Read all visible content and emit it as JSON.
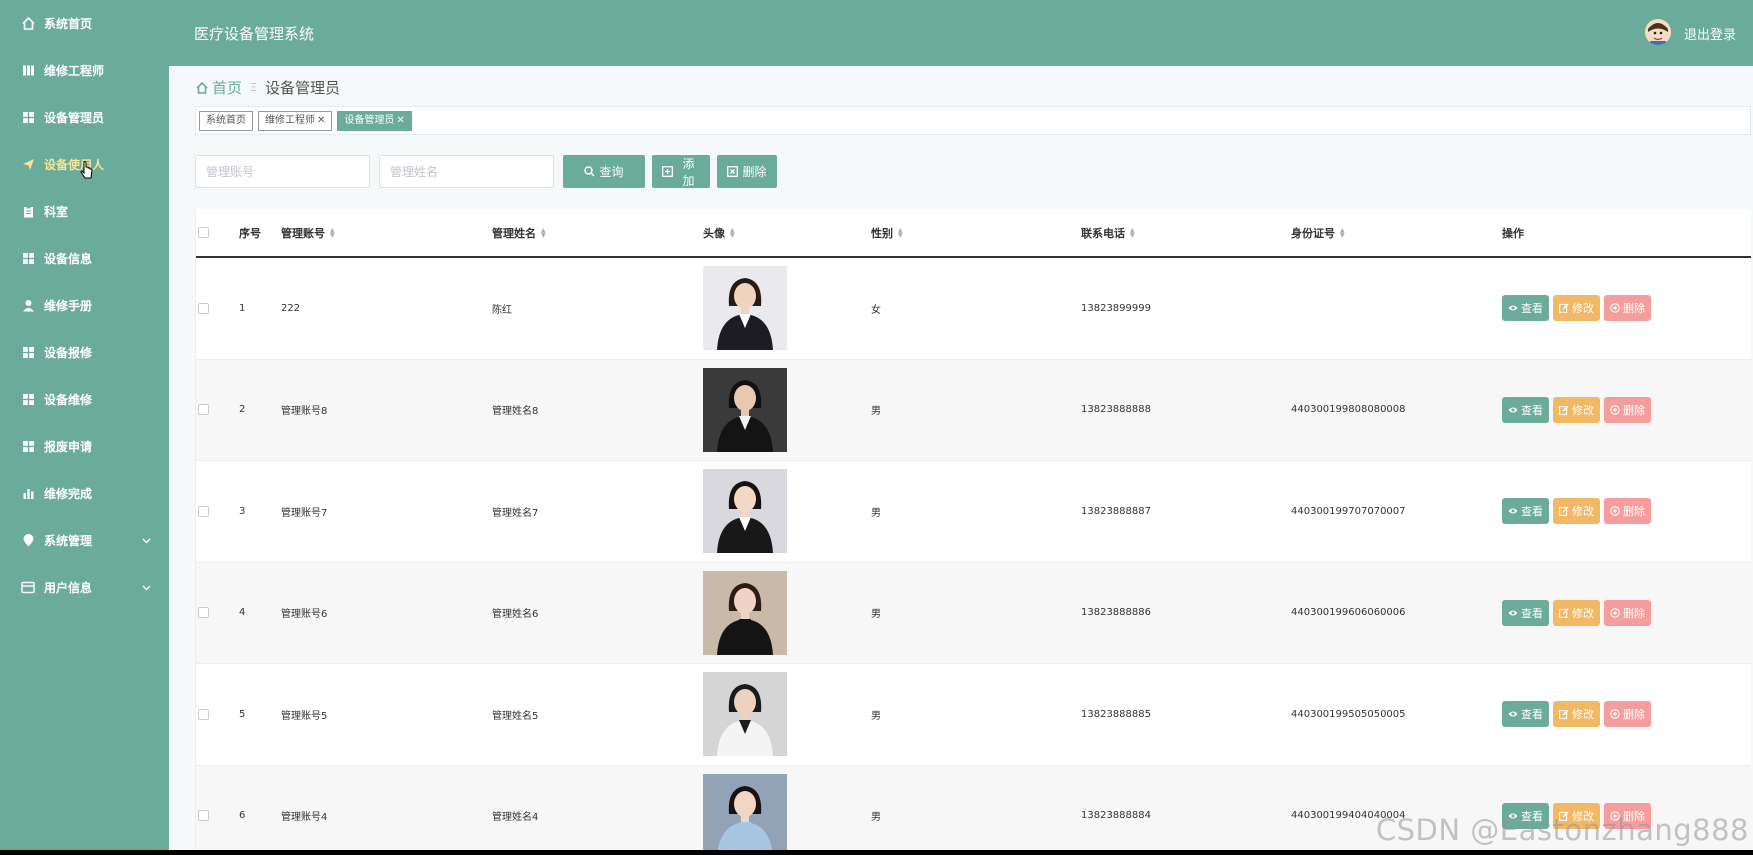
{
  "sidebar": {
    "items": [
      {
        "label": "系统首页",
        "icon": "home-icon"
      },
      {
        "label": "维修工程师",
        "icon": "book-icon"
      },
      {
        "label": "设备管理员",
        "icon": "grid-icon"
      },
      {
        "label": "设备使用人",
        "icon": "send-icon"
      },
      {
        "label": "科室",
        "icon": "clipboard-icon"
      },
      {
        "label": "设备信息",
        "icon": "grid-icon"
      },
      {
        "label": "维修手册",
        "icon": "user-icon"
      },
      {
        "label": "设备报修",
        "icon": "grid-icon"
      },
      {
        "label": "设备维修",
        "icon": "grid-icon"
      },
      {
        "label": "报废申请",
        "icon": "grid-icon"
      },
      {
        "label": "维修完成",
        "icon": "chart-icon"
      },
      {
        "label": "系统管理",
        "icon": "location-icon"
      },
      {
        "label": "用户信息",
        "icon": "card-icon"
      }
    ],
    "active_index": 3,
    "active_color": "#f5e59a"
  },
  "header": {
    "title": "医疗设备管理系统",
    "logout": "退出登录"
  },
  "breadcrumb": {
    "home": "首页",
    "current": "设备管理员"
  },
  "tags": [
    {
      "label": "系统首页",
      "closable": false
    },
    {
      "label": "维修工程师",
      "closable": true
    },
    {
      "label": "设备管理员",
      "closable": true
    }
  ],
  "search": {
    "account_placeholder": "管理账号",
    "name_placeholder": "管理姓名",
    "query_label": "查询",
    "add_label": "添加",
    "delete_label": "删除"
  },
  "table": {
    "headers": {
      "index": "序号",
      "account": "管理账号",
      "name": "管理姓名",
      "avatar": "头像",
      "gender": "性别",
      "phone": "联系电话",
      "id_card": "身份证号",
      "ops": "操作"
    },
    "row_actions": {
      "view": "查看",
      "edit": "修改",
      "delete": "删除"
    },
    "rows": [
      {
        "index": "1",
        "account": "222",
        "name": "陈红",
        "gender": "女",
        "phone": "13823899999",
        "id_card": ""
      },
      {
        "index": "2",
        "account": "管理账号8",
        "name": "管理姓名8",
        "gender": "男",
        "phone": "13823888888",
        "id_card": "440300199808080008"
      },
      {
        "index": "3",
        "account": "管理账号7",
        "name": "管理姓名7",
        "gender": "男",
        "phone": "13823888887",
        "id_card": "440300199707070007"
      },
      {
        "index": "4",
        "account": "管理账号6",
        "name": "管理姓名6",
        "gender": "男",
        "phone": "13823888886",
        "id_card": "440300199606060006"
      },
      {
        "index": "5",
        "account": "管理账号5",
        "name": "管理姓名5",
        "gender": "男",
        "phone": "13823888885",
        "id_card": "440300199505050005"
      },
      {
        "index": "6",
        "account": "管理账号4",
        "name": "管理姓名4",
        "gender": "男",
        "phone": "13823888884",
        "id_card": "440300199404040004"
      }
    ]
  },
  "colors": {
    "primary": "#6aab9a",
    "edit": "#f2b866",
    "delete": "#f59d9d"
  },
  "watermark": "CSDN @Eastonzhang888"
}
